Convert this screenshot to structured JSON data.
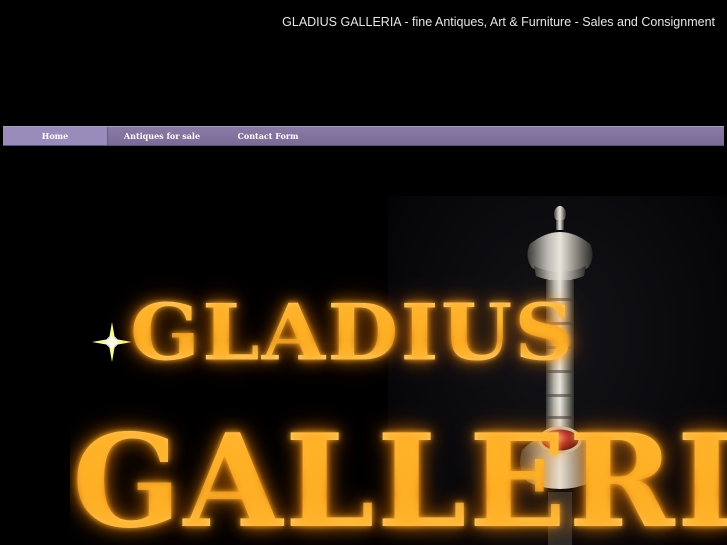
{
  "header": {
    "title": "GLADIUS GALLERIA - fine Antiques, Art & Furniture - Sales and Consignment"
  },
  "nav": {
    "items": [
      {
        "label": "Home",
        "active": true
      },
      {
        "label": "Antiques for sale",
        "active": false
      },
      {
        "label": "Contact Form",
        "active": false
      }
    ]
  },
  "hero": {
    "logo_line_1": "GLADIUS",
    "logo_line_2": "GALLERIA"
  },
  "colors": {
    "background": "#000000",
    "nav_bar": "#7a6b96",
    "nav_active": "#9a8cba",
    "logo_gold": "#f0c860"
  }
}
